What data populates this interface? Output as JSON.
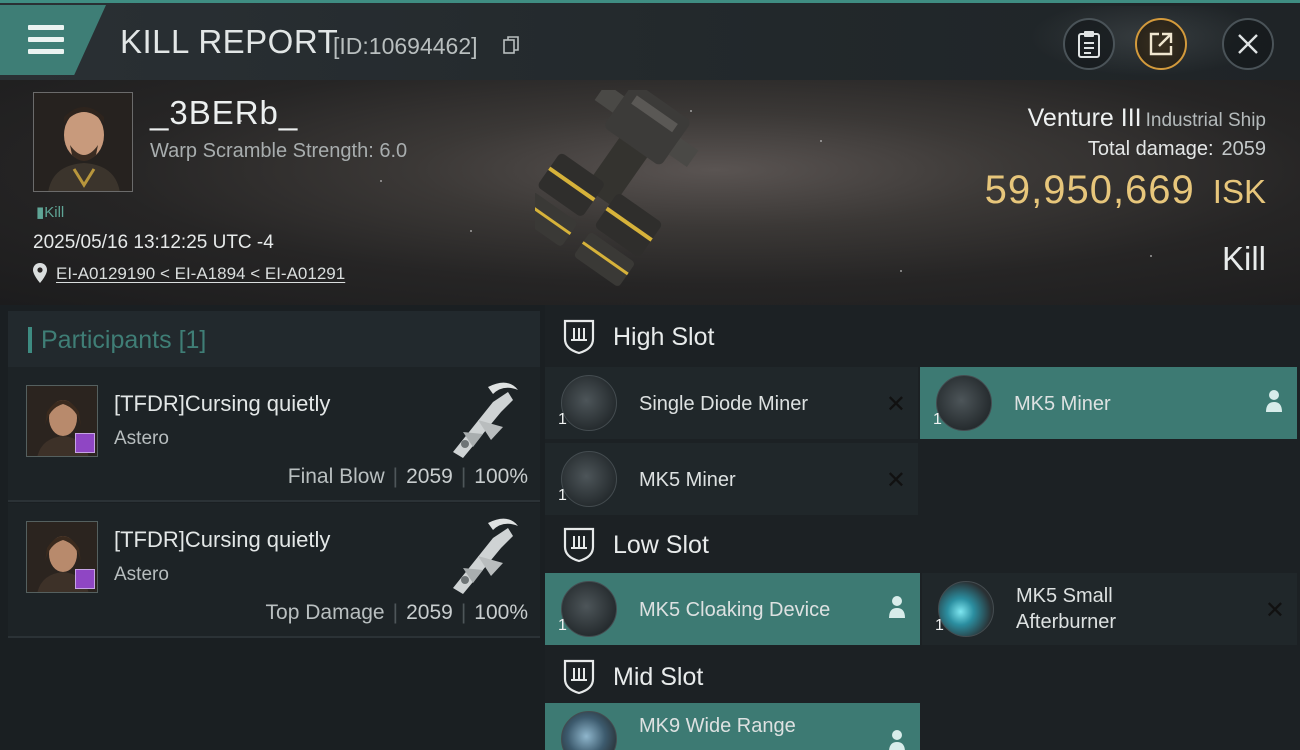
{
  "header": {
    "title": "KILL REPORT",
    "report_id": "[ID:10694462]"
  },
  "victim": {
    "name": "_3BERb_",
    "warp_scramble": "Warp Scramble Strength: 6.0",
    "kill_tag": "Kill",
    "datetime": "2025/05/16 13:12:25 UTC -4",
    "location": "EI-A0129190 < EI-A1894 < EI-A01291",
    "ship_name": "Venture III",
    "ship_class": "Industrial Ship",
    "total_damage_label": "Total damage:",
    "total_damage": "2059",
    "isk_value": "59,950,669",
    "isk_unit": "ISK",
    "result": "Kill"
  },
  "participants": {
    "title": "Participants",
    "count": "[1]",
    "rows": [
      {
        "name": "[TFDR]Cursing quietly",
        "ship": "Astero",
        "label": "Final Blow",
        "damage": "2059",
        "percent": "100%"
      },
      {
        "name": "[TFDR]Cursing quietly",
        "ship": "Astero",
        "label": "Top Damage",
        "damage": "2059",
        "percent": "100%"
      }
    ]
  },
  "fittings": {
    "high_slot": {
      "title": "High Slot",
      "modules": [
        {
          "qty": "1",
          "name": "Single Diode Miner",
          "status": "destroyed"
        },
        {
          "qty": "1",
          "name": "MK5 Miner",
          "status": "dropped"
        },
        {
          "qty": "1",
          "name": "MK5 Miner",
          "status": "destroyed"
        }
      ]
    },
    "low_slot": {
      "title": "Low Slot",
      "modules": [
        {
          "qty": "1",
          "name": "MK5 Cloaking Device",
          "status": "dropped"
        },
        {
          "qty": "1",
          "name_line1": "MK5 Small",
          "name_line2": "Afterburner",
          "status": "destroyed"
        }
      ]
    },
    "mid_slot": {
      "title": "Mid Slot",
      "modules": [
        {
          "qty": "1",
          "name": "MK9 Wide Range",
          "status": "dropped"
        }
      ]
    }
  },
  "colors": {
    "accent_teal": "#3d7a73",
    "isk_gold": "#e7c67b",
    "share_ring": "#d39a3c",
    "corp_badge": "#8f46c4"
  },
  "icons": [
    "menu-icon",
    "copy-icon",
    "clipboard-icon",
    "share-icon",
    "close-icon",
    "location-pin-icon",
    "shield-slot-icon",
    "destroyed-x-icon",
    "person-icon"
  ]
}
